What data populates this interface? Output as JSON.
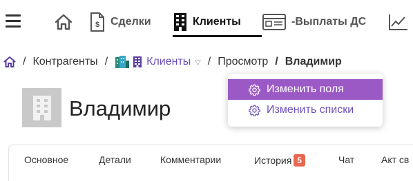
{
  "nav": {
    "items": [
      {
        "id": "home",
        "icon": "home-icon",
        "label": ""
      },
      {
        "id": "deals",
        "icon": "deals-document-icon",
        "label": "Сделки"
      },
      {
        "id": "clients",
        "icon": "building-icon",
        "label": "Клиенты",
        "active": true
      },
      {
        "id": "payouts",
        "icon": "id-card-icon",
        "label": "-Выплаты ДС"
      },
      {
        "id": "reports",
        "icon": "chart-icon",
        "label": ""
      }
    ]
  },
  "breadcrumb": {
    "contractors": "Контрагенты",
    "clients": "Клиенты",
    "view": "Просмотр",
    "current": "Владимир",
    "separator": "/"
  },
  "header": {
    "title": "Владимир"
  },
  "dropdown": {
    "items": [
      {
        "label": "Изменить поля",
        "icon": "gear-icon",
        "highlighted": true
      },
      {
        "label": "Изменить списки",
        "icon": "gear-icon",
        "highlighted": false
      }
    ]
  },
  "tabs": [
    {
      "label": "Основное"
    },
    {
      "label": "Детали"
    },
    {
      "label": "Комментарии"
    },
    {
      "label": "История",
      "badge": "5"
    },
    {
      "label": "Чат"
    },
    {
      "label": "Акт св"
    }
  ],
  "colors": {
    "accent": "#6b4fbb",
    "menu_highlight": "#9b59c6",
    "badge": "#e8674e",
    "avatar_bg": "#c9c9c9"
  }
}
